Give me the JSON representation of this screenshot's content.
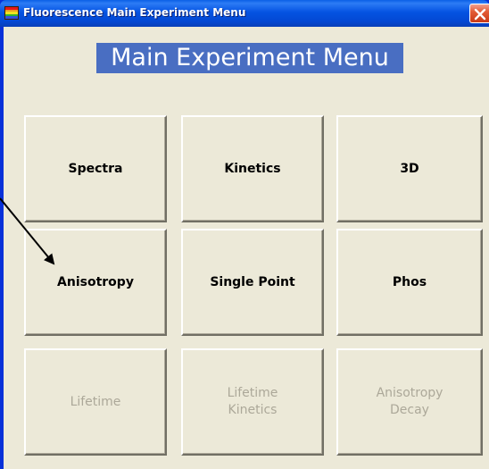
{
  "window": {
    "title": "Fluorescence Main Experiment Menu",
    "icon": "rainbow-app-icon",
    "close_icon": "close-icon"
  },
  "colors": {
    "title_bar": "#0553e2",
    "heading_bg": "#496ec2",
    "client_bg": "#ece9d8",
    "disabled_text": "#aca899",
    "close_button": "#e25b35"
  },
  "main": {
    "heading": "Main Experiment Menu",
    "buttons": [
      {
        "label": "Spectra",
        "enabled": true
      },
      {
        "label": "Kinetics",
        "enabled": true
      },
      {
        "label": "3D",
        "enabled": true
      },
      {
        "label": "Anisotropy",
        "enabled": true
      },
      {
        "label": "Single Point",
        "enabled": true
      },
      {
        "label": "Phos",
        "enabled": true
      },
      {
        "label": "Lifetime",
        "enabled": false
      },
      {
        "label": "Lifetime\nKinetics",
        "enabled": false
      },
      {
        "label": "Anisotropy\nDecay",
        "enabled": false
      }
    ]
  },
  "annotation": {
    "arrow_target": "Anisotropy"
  }
}
